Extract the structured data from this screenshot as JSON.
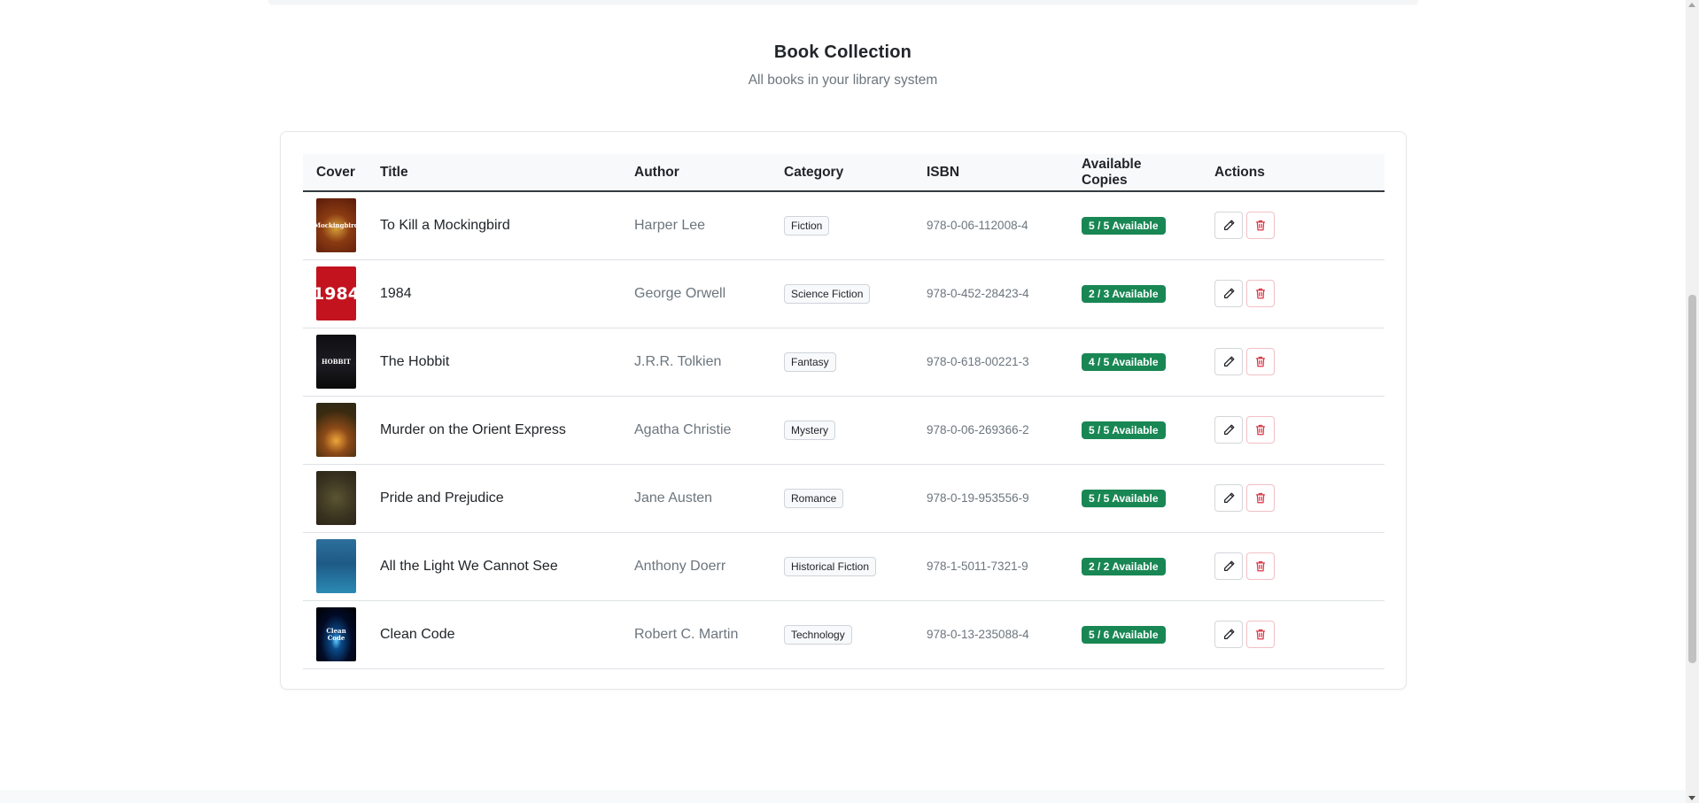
{
  "header": {
    "title": "Book Collection",
    "subtitle": "All books in your library system"
  },
  "table": {
    "columns": [
      "Cover",
      "Title",
      "Author",
      "Category",
      "ISBN",
      "Available Copies",
      "Actions"
    ],
    "rows": [
      {
        "title": "To Kill a Mockingbird",
        "author": "Harper Lee",
        "category": "Fiction",
        "isbn": "978-0-06-112008-4",
        "available": "5 / 5 Available",
        "cover_text": "Mockingbird"
      },
      {
        "title": "1984",
        "author": "George Orwell",
        "category": "Science Fiction",
        "isbn": "978-0-452-28423-4",
        "available": "2 / 3 Available",
        "cover_text": "1984"
      },
      {
        "title": "The Hobbit",
        "author": "J.R.R. Tolkien",
        "category": "Fantasy",
        "isbn": "978-0-618-00221-3",
        "available": "4 / 5 Available",
        "cover_text": "HOBBIT"
      },
      {
        "title": "Murder on the Orient Express",
        "author": "Agatha Christie",
        "category": "Mystery",
        "isbn": "978-0-06-269366-2",
        "available": "5 / 5 Available",
        "cover_text": ""
      },
      {
        "title": "Pride and Prejudice",
        "author": "Jane Austen",
        "category": "Romance",
        "isbn": "978-0-19-953556-9",
        "available": "5 / 5 Available",
        "cover_text": ""
      },
      {
        "title": "All the Light We Cannot See",
        "author": "Anthony Doerr",
        "category": "Historical Fiction",
        "isbn": "978-1-5011-7321-9",
        "available": "2 / 2 Available",
        "cover_text": ""
      },
      {
        "title": "Clean Code",
        "author": "Robert C. Martin",
        "category": "Technology",
        "isbn": "978-0-13-235088-4",
        "available": "5 / 6 Available",
        "cover_text": "Clean Code"
      }
    ]
  },
  "icons": {
    "edit": "pencil-icon",
    "delete": "trash-icon"
  },
  "colors": {
    "available_badge": "#198754",
    "delete_icon": "#dc3545",
    "header_border": "#343a40"
  }
}
